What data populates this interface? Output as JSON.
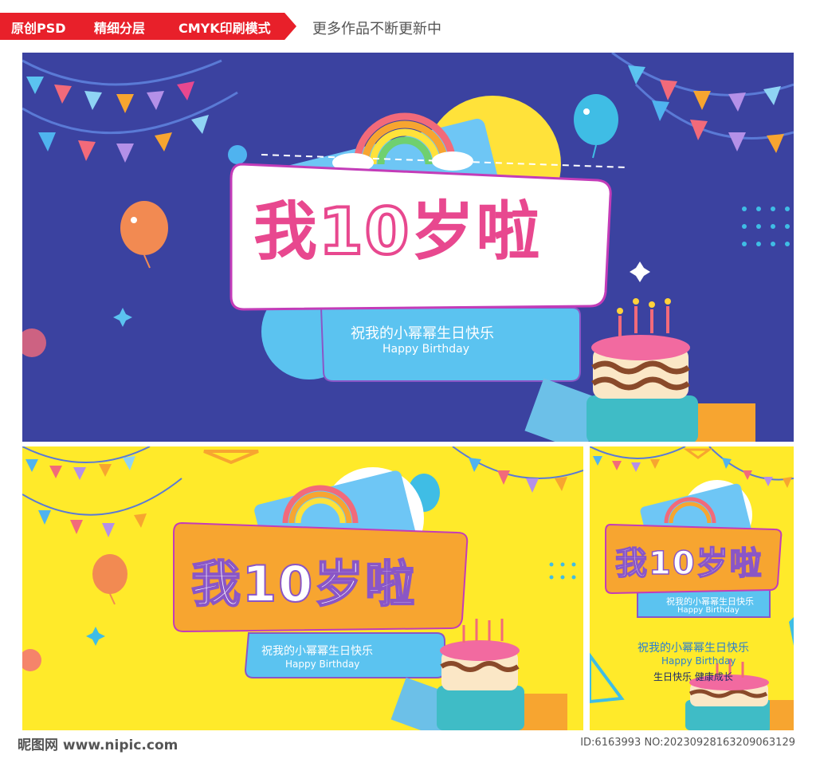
{
  "header": {
    "tag1": "原创PSD",
    "tag2": "精细分层",
    "tag3": "CMYK印刷模式",
    "more": "更多作品不断更新中"
  },
  "banner": {
    "title_pre": "我",
    "title_num": "10",
    "title_post": "岁啦",
    "subtitle": "祝我的小幂幂生日快乐",
    "english": "Happy Birthday",
    "wish": "生日快乐 健康成长"
  },
  "footer": {
    "site": "昵图网 www.nipic.com",
    "id": "ID:6163993 NO:20230928163209063129"
  },
  "colors": {
    "navy": "#3b42a0",
    "yellow": "#ffea2a",
    "pink": "#e8488f",
    "sky": "#5bc3f0",
    "orange": "#f7a530"
  }
}
